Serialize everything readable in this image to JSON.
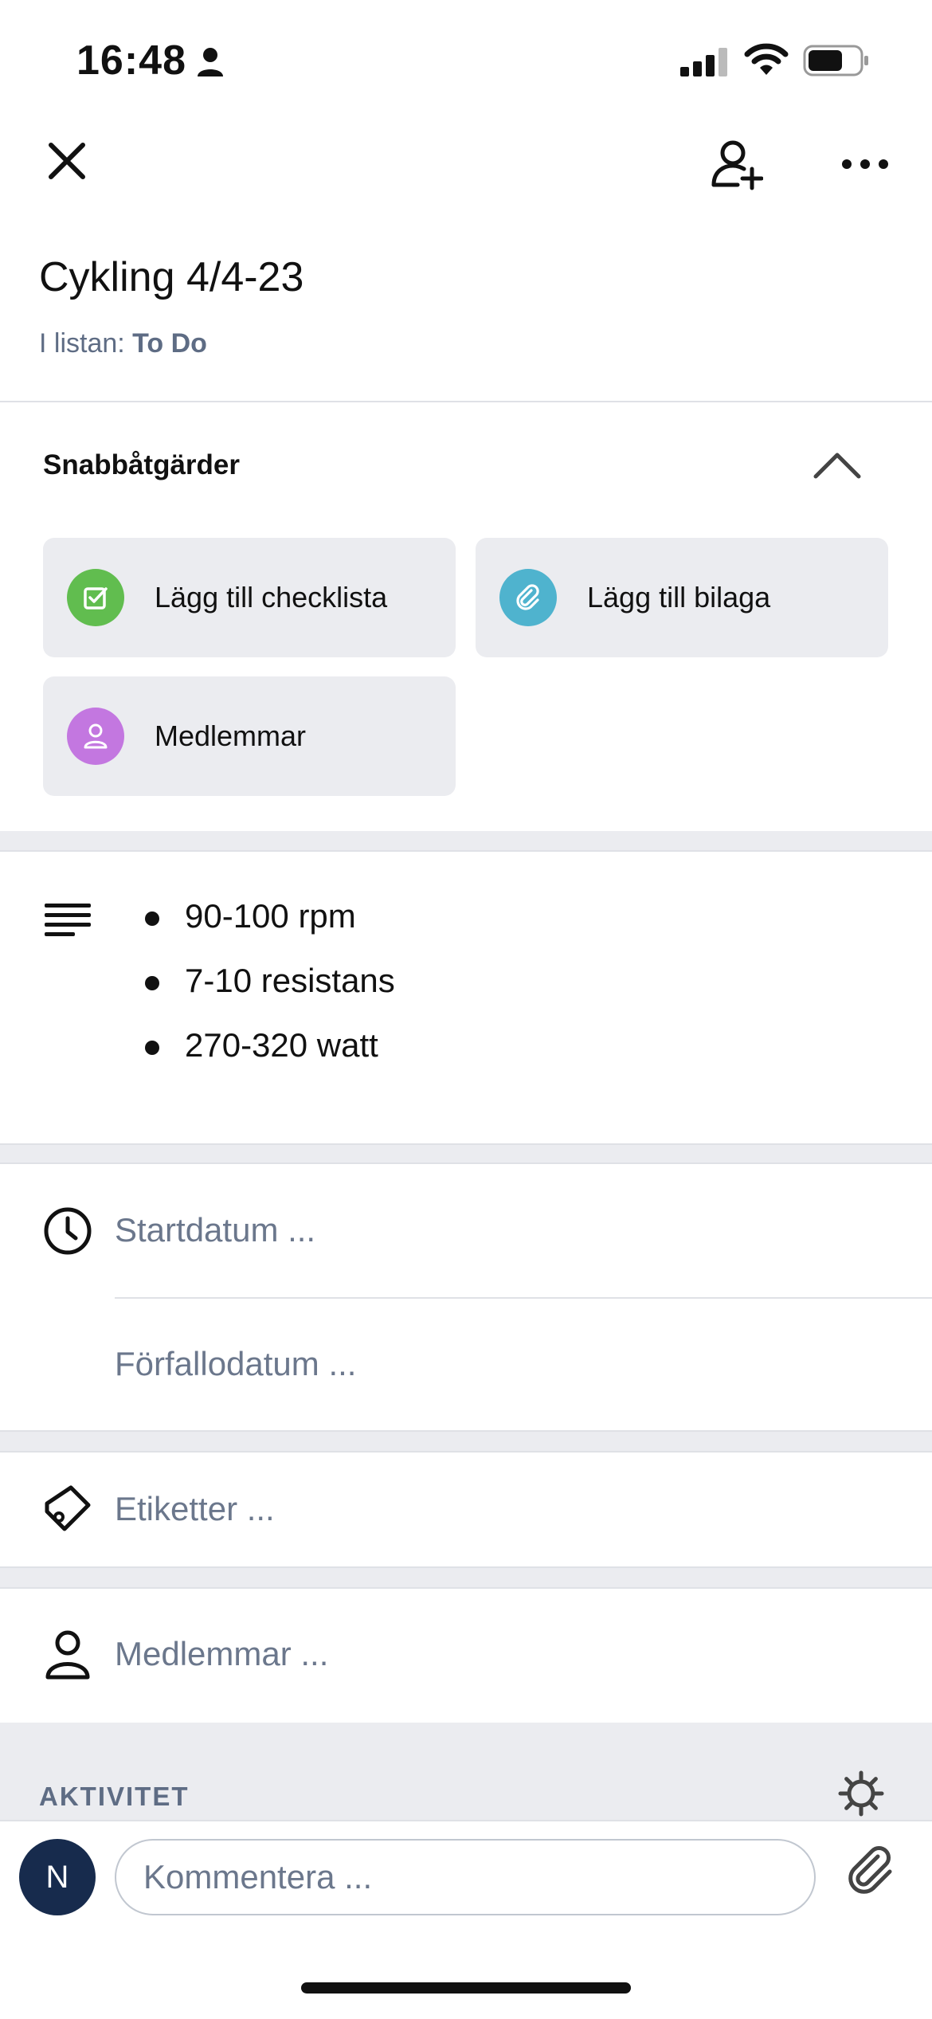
{
  "status_bar": {
    "time": "16:48"
  },
  "card": {
    "title": "Cykling 4/4-23",
    "list_prefix": "I listan: ",
    "list_name": "To Do"
  },
  "quick_actions": {
    "title": "Snabbåtgärder",
    "buttons": [
      {
        "label": "Lägg till checklista",
        "icon": "checklist-icon",
        "color": "#61bd4f"
      },
      {
        "label": "Lägg till bilaga",
        "icon": "paperclip-icon",
        "color": "#4fb3ce"
      },
      {
        "label": "Medlemmar",
        "icon": "person-icon",
        "color": "#c377e0"
      }
    ]
  },
  "description": {
    "items": [
      "90-100 rpm",
      "7-10 resistans",
      "270-320 watt"
    ]
  },
  "dates": {
    "start_placeholder": "Startdatum ...",
    "due_placeholder": "Förfallodatum ..."
  },
  "labels": {
    "placeholder": "Etiketter ..."
  },
  "members": {
    "placeholder": "Medlemmar ..."
  },
  "activity": {
    "heading": "AKTIVITET"
  },
  "comment": {
    "avatar_initial": "N",
    "placeholder": "Kommentera ..."
  },
  "colors": {
    "checklist_green": "#61bd4f",
    "attachment_blue": "#4fb3ce",
    "members_purple": "#c377e0",
    "avatar_navy": "#172b4d"
  }
}
